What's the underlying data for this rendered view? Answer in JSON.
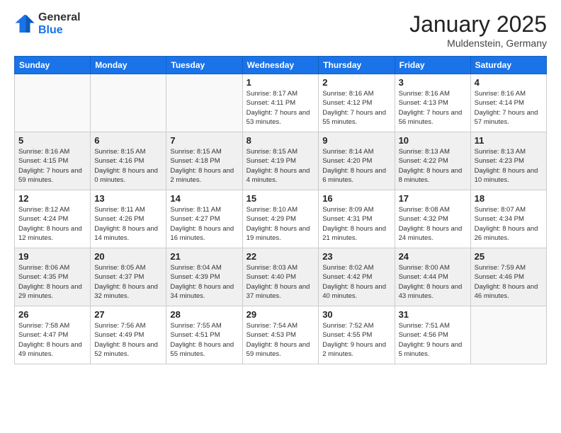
{
  "header": {
    "logo_general": "General",
    "logo_blue": "Blue",
    "month_title": "January 2025",
    "location": "Muldenstein, Germany"
  },
  "weekdays": [
    "Sunday",
    "Monday",
    "Tuesday",
    "Wednesday",
    "Thursday",
    "Friday",
    "Saturday"
  ],
  "weeks": [
    [
      {
        "day": "",
        "info": ""
      },
      {
        "day": "",
        "info": ""
      },
      {
        "day": "",
        "info": ""
      },
      {
        "day": "1",
        "info": "Sunrise: 8:17 AM\nSunset: 4:11 PM\nDaylight: 7 hours and 53 minutes."
      },
      {
        "day": "2",
        "info": "Sunrise: 8:16 AM\nSunset: 4:12 PM\nDaylight: 7 hours and 55 minutes."
      },
      {
        "day": "3",
        "info": "Sunrise: 8:16 AM\nSunset: 4:13 PM\nDaylight: 7 hours and 56 minutes."
      },
      {
        "day": "4",
        "info": "Sunrise: 8:16 AM\nSunset: 4:14 PM\nDaylight: 7 hours and 57 minutes."
      }
    ],
    [
      {
        "day": "5",
        "info": "Sunrise: 8:16 AM\nSunset: 4:15 PM\nDaylight: 7 hours and 59 minutes."
      },
      {
        "day": "6",
        "info": "Sunrise: 8:15 AM\nSunset: 4:16 PM\nDaylight: 8 hours and 0 minutes."
      },
      {
        "day": "7",
        "info": "Sunrise: 8:15 AM\nSunset: 4:18 PM\nDaylight: 8 hours and 2 minutes."
      },
      {
        "day": "8",
        "info": "Sunrise: 8:15 AM\nSunset: 4:19 PM\nDaylight: 8 hours and 4 minutes."
      },
      {
        "day": "9",
        "info": "Sunrise: 8:14 AM\nSunset: 4:20 PM\nDaylight: 8 hours and 6 minutes."
      },
      {
        "day": "10",
        "info": "Sunrise: 8:13 AM\nSunset: 4:22 PM\nDaylight: 8 hours and 8 minutes."
      },
      {
        "day": "11",
        "info": "Sunrise: 8:13 AM\nSunset: 4:23 PM\nDaylight: 8 hours and 10 minutes."
      }
    ],
    [
      {
        "day": "12",
        "info": "Sunrise: 8:12 AM\nSunset: 4:24 PM\nDaylight: 8 hours and 12 minutes."
      },
      {
        "day": "13",
        "info": "Sunrise: 8:11 AM\nSunset: 4:26 PM\nDaylight: 8 hours and 14 minutes."
      },
      {
        "day": "14",
        "info": "Sunrise: 8:11 AM\nSunset: 4:27 PM\nDaylight: 8 hours and 16 minutes."
      },
      {
        "day": "15",
        "info": "Sunrise: 8:10 AM\nSunset: 4:29 PM\nDaylight: 8 hours and 19 minutes."
      },
      {
        "day": "16",
        "info": "Sunrise: 8:09 AM\nSunset: 4:31 PM\nDaylight: 8 hours and 21 minutes."
      },
      {
        "day": "17",
        "info": "Sunrise: 8:08 AM\nSunset: 4:32 PM\nDaylight: 8 hours and 24 minutes."
      },
      {
        "day": "18",
        "info": "Sunrise: 8:07 AM\nSunset: 4:34 PM\nDaylight: 8 hours and 26 minutes."
      }
    ],
    [
      {
        "day": "19",
        "info": "Sunrise: 8:06 AM\nSunset: 4:35 PM\nDaylight: 8 hours and 29 minutes."
      },
      {
        "day": "20",
        "info": "Sunrise: 8:05 AM\nSunset: 4:37 PM\nDaylight: 8 hours and 32 minutes."
      },
      {
        "day": "21",
        "info": "Sunrise: 8:04 AM\nSunset: 4:39 PM\nDaylight: 8 hours and 34 minutes."
      },
      {
        "day": "22",
        "info": "Sunrise: 8:03 AM\nSunset: 4:40 PM\nDaylight: 8 hours and 37 minutes."
      },
      {
        "day": "23",
        "info": "Sunrise: 8:02 AM\nSunset: 4:42 PM\nDaylight: 8 hours and 40 minutes."
      },
      {
        "day": "24",
        "info": "Sunrise: 8:00 AM\nSunset: 4:44 PM\nDaylight: 8 hours and 43 minutes."
      },
      {
        "day": "25",
        "info": "Sunrise: 7:59 AM\nSunset: 4:46 PM\nDaylight: 8 hours and 46 minutes."
      }
    ],
    [
      {
        "day": "26",
        "info": "Sunrise: 7:58 AM\nSunset: 4:47 PM\nDaylight: 8 hours and 49 minutes."
      },
      {
        "day": "27",
        "info": "Sunrise: 7:56 AM\nSunset: 4:49 PM\nDaylight: 8 hours and 52 minutes."
      },
      {
        "day": "28",
        "info": "Sunrise: 7:55 AM\nSunset: 4:51 PM\nDaylight: 8 hours and 55 minutes."
      },
      {
        "day": "29",
        "info": "Sunrise: 7:54 AM\nSunset: 4:53 PM\nDaylight: 8 hours and 59 minutes."
      },
      {
        "day": "30",
        "info": "Sunrise: 7:52 AM\nSunset: 4:55 PM\nDaylight: 9 hours and 2 minutes."
      },
      {
        "day": "31",
        "info": "Sunrise: 7:51 AM\nSunset: 4:56 PM\nDaylight: 9 hours and 5 minutes."
      },
      {
        "day": "",
        "info": ""
      }
    ]
  ]
}
